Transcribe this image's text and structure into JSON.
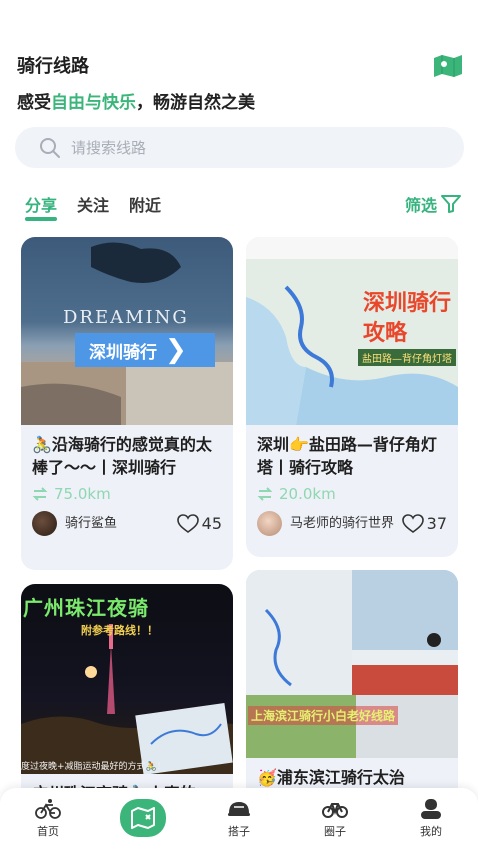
{
  "header": {
    "title": "骑行线路",
    "subtitle_prefix": "感受",
    "subtitle_accent": "自由与快乐",
    "subtitle_suffix": "，畅游自然之美"
  },
  "search": {
    "placeholder": "请搜索线路"
  },
  "tabs": [
    {
      "label": "分享",
      "active": true
    },
    {
      "label": "关注",
      "active": false
    },
    {
      "label": "附近",
      "active": false
    }
  ],
  "filter_label": "筛选",
  "cards": [
    {
      "image_caption": "深圳骑行",
      "image_text": "DREAMING",
      "title": "🚴沿海骑行的感觉真的太棒了～～丨深圳骑行",
      "distance": "75.0km",
      "user": "骑行鲨鱼",
      "likes": "45"
    },
    {
      "image_caption": "深圳骑行攻略",
      "image_sub": "盐田路—背仔角灯塔",
      "title": "深圳👉盐田路—背仔角灯塔丨骑行攻略",
      "distance": "20.0km",
      "user": "马老师的骑行世界",
      "likes": "37"
    },
    {
      "image_caption": "广州珠江夜骑",
      "image_sub": "附参考路线！！",
      "image_footer": "度过夜晚+减脂运动最好的方式🚴！",
      "title": "广州珠江夜骑🚴丨真的",
      "distance": "",
      "user": "",
      "likes": ""
    },
    {
      "image_caption": "上海滨江骑行小白老好线路",
      "title": "🥳浦东滨江骑行太治",
      "distance": "",
      "user": "",
      "likes": ""
    }
  ],
  "tabbar": [
    {
      "label": "首页",
      "icon": "bike-icon"
    },
    {
      "label": "",
      "icon": "map-route-icon"
    },
    {
      "label": "搭子",
      "icon": "helmet-icon"
    },
    {
      "label": "圈子",
      "icon": "bicycle-icon"
    },
    {
      "label": "我的",
      "icon": "user-icon"
    }
  ],
  "colors": {
    "accent": "#36b37e",
    "card_bg": "#eef1f8",
    "search_bg": "#f0f3f8"
  }
}
